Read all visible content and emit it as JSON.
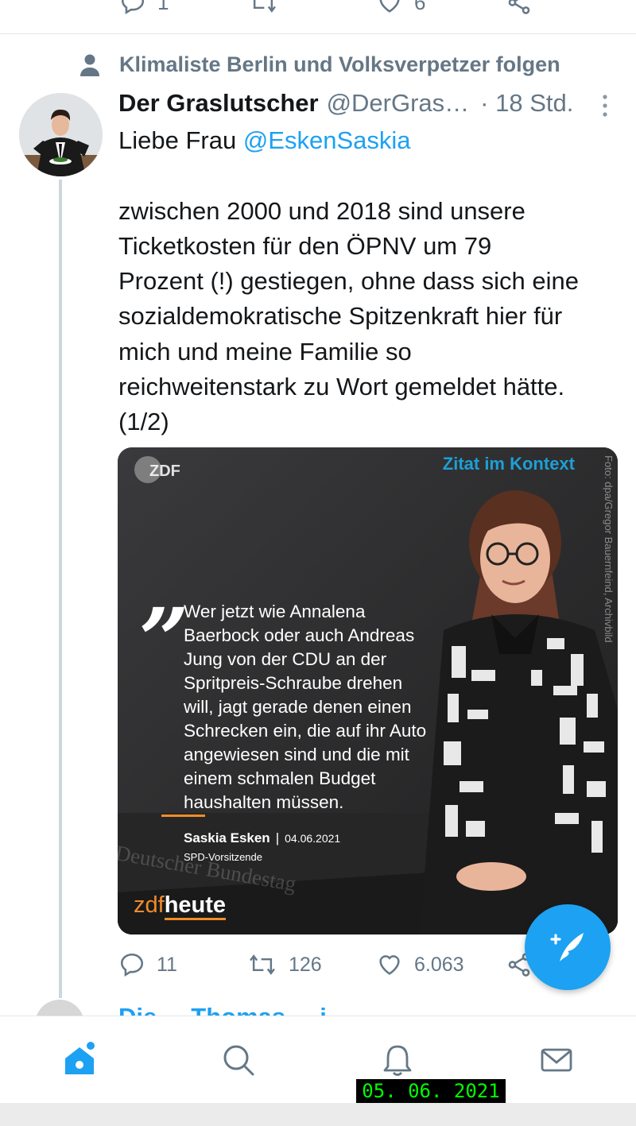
{
  "previous_tweet": {
    "reply_count": "1",
    "like_count": "6"
  },
  "social_context": {
    "text": "Klimaliste Berlin und Volksverpetzer folgen"
  },
  "tweet": {
    "display_name": "Der Graslutscher",
    "handle": "@DerGras…",
    "time": "· 18 Std.",
    "text_prefix": "Liebe Frau ",
    "mention": "@EskenSaskia",
    "body_lines": [
      "zwischen 2000 und 2018 sind unsere",
      "Ticketkosten für den ÖPNV um 79",
      "Prozent (!) gestiegen, ohne dass sich eine",
      "sozialdemokratische Spitzenkraft hier für",
      "mich und meine Familie so",
      "reichweitenstark zu Wort gemeldet hätte.",
      "(1/2)"
    ],
    "actions": {
      "reply_count": "11",
      "retweet_count": "126",
      "like_count": "6.063"
    }
  },
  "media": {
    "logo": "ZDF",
    "corner_label": "Zitat im Kontext",
    "photo_credit": "Foto: dpa/Gregor Bauernfeind, Archivbild",
    "quote_lines": [
      "Wer jetzt wie Annalena",
      "Baerbock oder auch Andreas",
      "Jung von der CDU an der",
      "Spritpreis-Schraube drehen",
      "will, jagt gerade denen einen",
      "Schrecken ein, die auf ihr Auto",
      "angewiesen sind und die mit",
      "einem schmalen Budget",
      "haushalten müssen."
    ],
    "speaker_name": "Saskia Esken",
    "separator": "|",
    "quote_date": "04.06.2021",
    "speaker_role": "SPD-Vorsitzende",
    "background_text": "Deutscher Bundestag",
    "brand_zdf": "zdf",
    "brand_heute": "heute"
  },
  "next_tweet": {
    "name_partial": "Die ... Thomas ... i..."
  },
  "date_stamp": "05. 06. 2021",
  "colors": {
    "accent": "#1da1f2",
    "secondary_text": "#657786",
    "zdf_orange": "#f28c28",
    "stamp_green": "#00ff00"
  },
  "icons": [
    "person-icon",
    "more-vert-icon",
    "reply-icon",
    "retweet-icon",
    "like-icon",
    "share-icon",
    "compose-icon",
    "home-icon",
    "search-icon",
    "notifications-icon",
    "messages-icon"
  ]
}
